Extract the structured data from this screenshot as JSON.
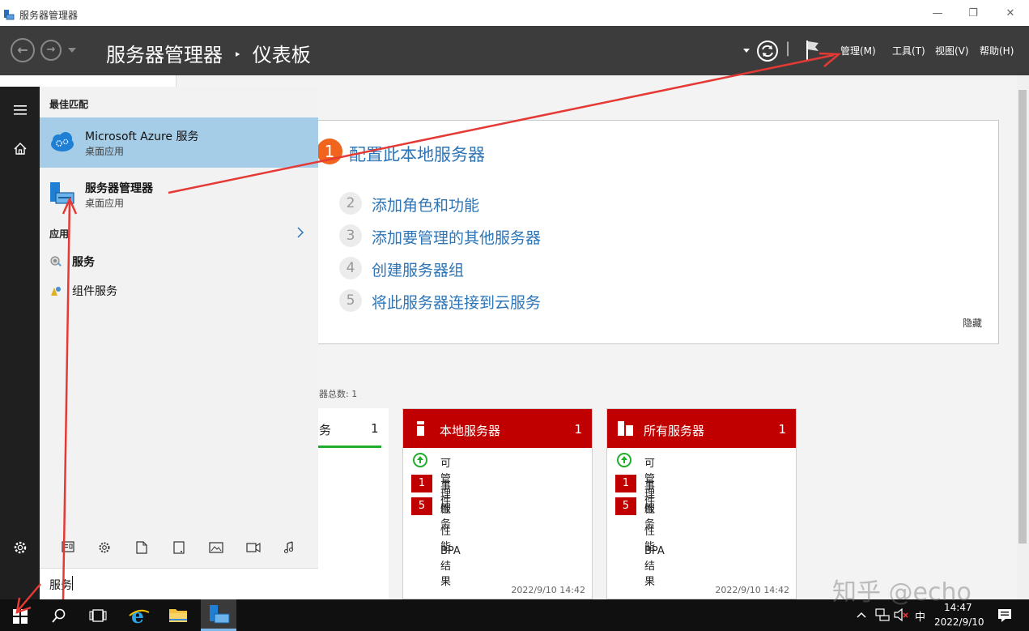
{
  "window": {
    "title": "服务器管理器",
    "controls": {
      "minimize": "—",
      "restore": "❐",
      "close": "✕"
    }
  },
  "header": {
    "breadcrumb_root": "服务器管理器",
    "breadcrumb_sep": "‣",
    "breadcrumb_page": "仪表板",
    "menus": [
      "管理(M)",
      "工具(T)",
      "视图(V)",
      "帮助(H)"
    ],
    "separator": "|"
  },
  "quickstart": {
    "step1_number": "1",
    "step1_label": "配置此本地服务器",
    "steps": [
      {
        "number": "2",
        "label": "添加角色和功能"
      },
      {
        "number": "3",
        "label": "添加要管理的其他服务器"
      },
      {
        "number": "4",
        "label": "创建服务器组"
      },
      {
        "number": "5",
        "label": "将此服务器连接到云服务"
      }
    ],
    "hide_link": "隐藏"
  },
  "roles_summary": {
    "total_text": "器总数: 1",
    "partial_tile_label": "务",
    "partial_tile_count": "1"
  },
  "tiles": [
    {
      "name": "本地服务器",
      "count": "1",
      "rows": [
        {
          "badge": "",
          "label": "可管理性"
        },
        {
          "badge": "1",
          "label": "事件"
        },
        {
          "badge": "5",
          "label": "服务"
        },
        {
          "badge": "",
          "label": "性能"
        },
        {
          "badge": "",
          "label": "BPA 结果"
        }
      ],
      "timestamp": "2022/9/10 14:42"
    },
    {
      "name": "所有服务器",
      "count": "1",
      "rows": [
        {
          "badge": "",
          "label": "可管理性"
        },
        {
          "badge": "1",
          "label": "事件"
        },
        {
          "badge": "5",
          "label": "服务"
        },
        {
          "badge": "",
          "label": "性能"
        },
        {
          "badge": "",
          "label": "BPA 结果"
        }
      ],
      "timestamp": "2022/9/10 14:42"
    }
  ],
  "start_menu": {
    "best_match_header": "最佳匹配",
    "best_match": {
      "name": "Microsoft Azure 服务",
      "type": "桌面应用"
    },
    "second_match": {
      "name": "服务器管理器",
      "type": "桌面应用"
    },
    "apps_header": "应用",
    "apps": [
      "服务",
      "组件服务"
    ],
    "search_value": "服务"
  },
  "taskbar": {
    "time": "14:47",
    "date": "2022/9/10",
    "ime": "中"
  },
  "watermark": "知乎 @echo",
  "colors": {
    "header_bg": "#3c3c3c",
    "tile_red": "#c00000",
    "link_blue": "#2e75b6",
    "step1_orange": "#f0641e",
    "best_match_bg": "#a6cde8",
    "annotation_arrow": "#e53935"
  }
}
